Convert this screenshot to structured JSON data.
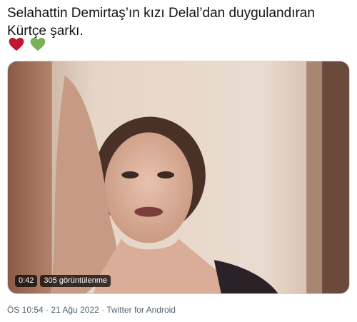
{
  "tweet": {
    "text": "Selahattin Demirtaş’ın kızı Delal’dan duygulandıran Kürtçe şarkı.",
    "emojis": [
      "red-heart",
      "green-heart"
    ],
    "colors": {
      "red_heart": "#be1931",
      "green_heart": "#77b255"
    }
  },
  "video": {
    "duration": "0:42",
    "views": "305 görüntülenme"
  },
  "meta": {
    "time": "ÖS 10:54",
    "separator1": "·",
    "date": "21 Ağu 2022",
    "separator2": "·",
    "source": "Twitter for Android"
  }
}
